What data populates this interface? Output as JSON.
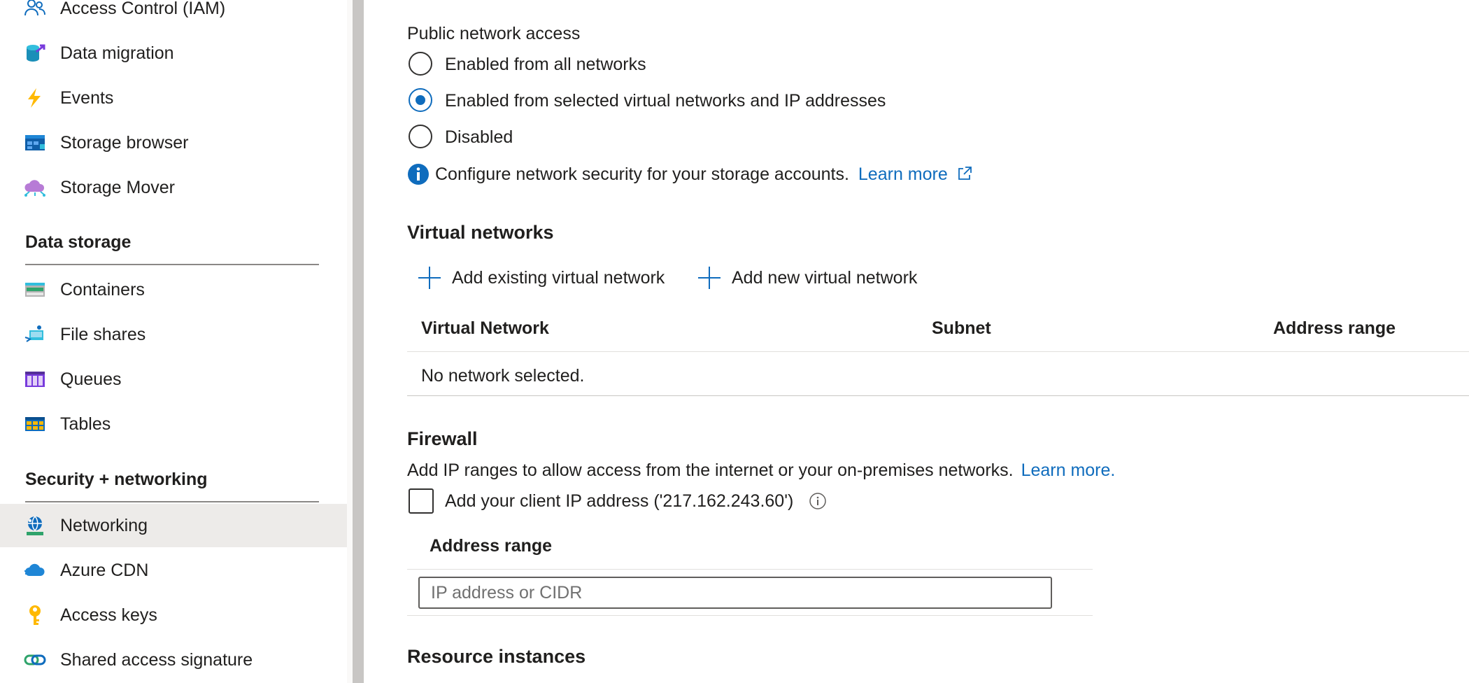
{
  "sidebar": {
    "items_top": [
      {
        "label": "Access Control (IAM)",
        "icon": "iam-users-icon"
      },
      {
        "label": "Data migration",
        "icon": "data-migration-icon"
      },
      {
        "label": "Events",
        "icon": "events-bolt-icon"
      },
      {
        "label": "Storage browser",
        "icon": "storage-browser-icon"
      },
      {
        "label": "Storage Mover",
        "icon": "storage-mover-icon"
      }
    ],
    "section_data_storage": "Data storage",
    "items_data_storage": [
      {
        "label": "Containers",
        "icon": "containers-icon"
      },
      {
        "label": "File shares",
        "icon": "file-shares-icon"
      },
      {
        "label": "Queues",
        "icon": "queues-icon"
      },
      {
        "label": "Tables",
        "icon": "tables-icon"
      }
    ],
    "section_security": "Security + networking",
    "items_security": [
      {
        "label": "Networking",
        "icon": "networking-globe-icon",
        "selected": true
      },
      {
        "label": "Azure CDN",
        "icon": "azure-cdn-cloud-icon"
      },
      {
        "label": "Access keys",
        "icon": "access-keys-icon"
      },
      {
        "label": "Shared access signature",
        "icon": "shared-access-signature-icon"
      }
    ]
  },
  "public_access": {
    "heading": "Public network access",
    "options": [
      {
        "label": "Enabled from all networks",
        "selected": false
      },
      {
        "label": "Enabled from selected virtual networks and IP addresses",
        "selected": true
      },
      {
        "label": "Disabled",
        "selected": false
      }
    ],
    "info_text": "Configure network security for your storage accounts.",
    "info_link": "Learn more"
  },
  "virtual_networks": {
    "heading": "Virtual networks",
    "add_existing": "Add existing virtual network",
    "add_new": "Add new virtual network",
    "columns": [
      "Virtual Network",
      "Subnet",
      "Address range"
    ],
    "empty_text": "No network selected."
  },
  "firewall": {
    "heading": "Firewall",
    "description": "Add IP ranges to allow access from the internet or your on-premises networks.",
    "learn_more": "Learn more.",
    "client_ip_label": "Add your client IP address ('217.162.243.60')",
    "client_ip_checked": false,
    "column": "Address range",
    "input_placeholder": "IP address or CIDR",
    "input_value": ""
  },
  "resource_instances": {
    "heading": "Resource instances"
  },
  "colors": {
    "accent": "#0f6cbd",
    "selected_nav_bg": "#edebe9",
    "splitter": "#c8c6c4"
  }
}
